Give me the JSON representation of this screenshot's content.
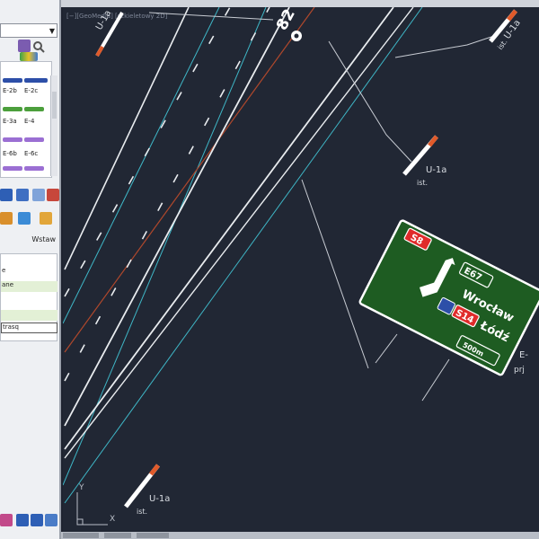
{
  "viewport": {
    "title": "[−][GeoMedia] [szkieletowy 2D]"
  },
  "palette": {
    "gallery_labels": [
      "E-2b",
      "E-2c",
      "E-3a",
      "E-4",
      "E-6b",
      "E-6c"
    ],
    "insert_button": "Wstaw",
    "properties": [
      "e",
      "ane",
      "trasq"
    ]
  },
  "drawing": {
    "signs": [
      {
        "code": "U-1a",
        "note": "ist."
      },
      {
        "code": "U-1a",
        "note": "ist."
      },
      {
        "code": "U-1a",
        "note": "ist."
      },
      {
        "code": "U-1a",
        "note": "ist."
      }
    ],
    "direction_sign": {
      "route_badge": "S8",
      "euro_route": "E67",
      "destination_1": "Wrocław",
      "motorway_badge": "S14",
      "destination_2": "Łódź",
      "distance": "500m",
      "code": "E-",
      "note": "prj"
    },
    "chainage_marker": "82",
    "ucs": {
      "x_label": "X",
      "y_label": "Y"
    }
  },
  "colors": {
    "canvas": "#212734",
    "road_line": "#e9ecef",
    "cyan_line": "#3fb7c7",
    "axis_line": "#b0482c",
    "sign_green": "#1e5c22",
    "sign_red": "#e02b2b"
  }
}
